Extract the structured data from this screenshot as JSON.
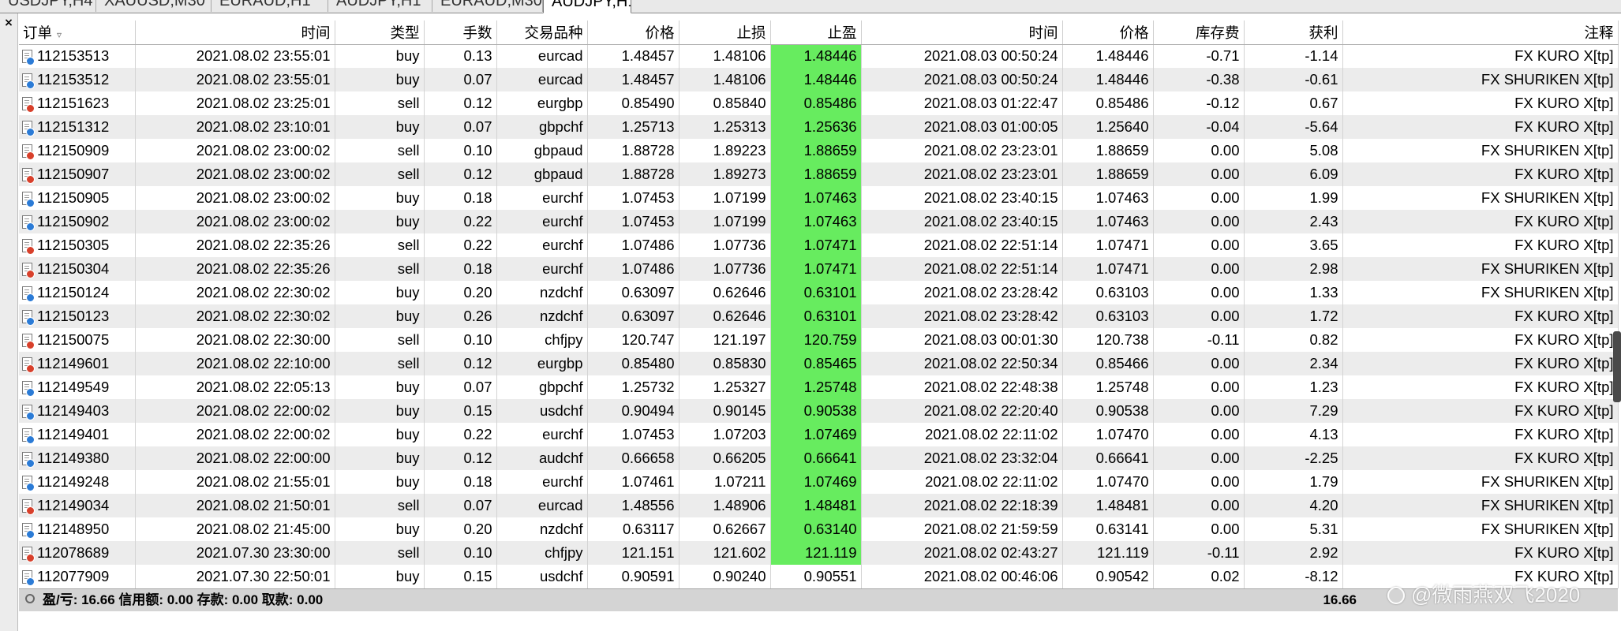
{
  "tabs": [
    {
      "label": "USDJPY,H4",
      "active": false
    },
    {
      "label": "XAUUSD,M30",
      "active": false
    },
    {
      "label": "EURAUD,H1",
      "active": false
    },
    {
      "label": "AUDJPY,H1",
      "active": false
    },
    {
      "label": "EURAUD,M30",
      "active": false
    },
    {
      "label": "AUDJPY,H1",
      "active": true
    }
  ],
  "close_label": "×",
  "columns": [
    "订单",
    "时间",
    "类型",
    "手数",
    "交易品种",
    "价格",
    "止损",
    "止盈",
    "时间",
    "价格",
    "库存费",
    "获利",
    "注释"
  ],
  "sort_indicator": "▿",
  "rows": [
    {
      "order": "112153513",
      "open_time": "2021.08.02 23:55:01",
      "type": "buy",
      "lots": "0.13",
      "symbol": "eurcad",
      "price": "1.48457",
      "sl": "1.48106",
      "tp": "1.48446",
      "close_time": "2021.08.03 00:50:24",
      "close_price": "1.48446",
      "swap": "-0.71",
      "profit": "-1.14",
      "comment": "FX KURO X[tp]",
      "tp_hit": true
    },
    {
      "order": "112153512",
      "open_time": "2021.08.02 23:55:01",
      "type": "buy",
      "lots": "0.07",
      "symbol": "eurcad",
      "price": "1.48457",
      "sl": "1.48106",
      "tp": "1.48446",
      "close_time": "2021.08.03 00:50:24",
      "close_price": "1.48446",
      "swap": "-0.38",
      "profit": "-0.61",
      "comment": "FX SHURIKEN X[tp]",
      "tp_hit": true
    },
    {
      "order": "112151623",
      "open_time": "2021.08.02 23:25:01",
      "type": "sell",
      "lots": "0.12",
      "symbol": "eurgbp",
      "price": "0.85490",
      "sl": "0.85840",
      "tp": "0.85486",
      "close_time": "2021.08.03 01:22:47",
      "close_price": "0.85486",
      "swap": "-0.12",
      "profit": "0.67",
      "comment": "FX KURO X[tp]",
      "tp_hit": true
    },
    {
      "order": "112151312",
      "open_time": "2021.08.02 23:10:01",
      "type": "buy",
      "lots": "0.07",
      "symbol": "gbpchf",
      "price": "1.25713",
      "sl": "1.25313",
      "tp": "1.25636",
      "close_time": "2021.08.03 01:00:05",
      "close_price": "1.25640",
      "swap": "-0.04",
      "profit": "-5.64",
      "comment": "FX KURO X[tp]",
      "tp_hit": true
    },
    {
      "order": "112150909",
      "open_time": "2021.08.02 23:00:02",
      "type": "sell",
      "lots": "0.10",
      "symbol": "gbpaud",
      "price": "1.88728",
      "sl": "1.89223",
      "tp": "1.88659",
      "close_time": "2021.08.02 23:23:01",
      "close_price": "1.88659",
      "swap": "0.00",
      "profit": "5.08",
      "comment": "FX SHURIKEN X[tp]",
      "tp_hit": true
    },
    {
      "order": "112150907",
      "open_time": "2021.08.02 23:00:02",
      "type": "sell",
      "lots": "0.12",
      "symbol": "gbpaud",
      "price": "1.88728",
      "sl": "1.89273",
      "tp": "1.88659",
      "close_time": "2021.08.02 23:23:01",
      "close_price": "1.88659",
      "swap": "0.00",
      "profit": "6.09",
      "comment": "FX KURO X[tp]",
      "tp_hit": true
    },
    {
      "order": "112150905",
      "open_time": "2021.08.02 23:00:02",
      "type": "buy",
      "lots": "0.18",
      "symbol": "eurchf",
      "price": "1.07453",
      "sl": "1.07199",
      "tp": "1.07463",
      "close_time": "2021.08.02 23:40:15",
      "close_price": "1.07463",
      "swap": "0.00",
      "profit": "1.99",
      "comment": "FX SHURIKEN X[tp]",
      "tp_hit": true
    },
    {
      "order": "112150902",
      "open_time": "2021.08.02 23:00:02",
      "type": "buy",
      "lots": "0.22",
      "symbol": "eurchf",
      "price": "1.07453",
      "sl": "1.07199",
      "tp": "1.07463",
      "close_time": "2021.08.02 23:40:15",
      "close_price": "1.07463",
      "swap": "0.00",
      "profit": "2.43",
      "comment": "FX KURO X[tp]",
      "tp_hit": true
    },
    {
      "order": "112150305",
      "open_time": "2021.08.02 22:35:26",
      "type": "sell",
      "lots": "0.22",
      "symbol": "eurchf",
      "price": "1.07486",
      "sl": "1.07736",
      "tp": "1.07471",
      "close_time": "2021.08.02 22:51:14",
      "close_price": "1.07471",
      "swap": "0.00",
      "profit": "3.65",
      "comment": "FX KURO X[tp]",
      "tp_hit": true
    },
    {
      "order": "112150304",
      "open_time": "2021.08.02 22:35:26",
      "type": "sell",
      "lots": "0.18",
      "symbol": "eurchf",
      "price": "1.07486",
      "sl": "1.07736",
      "tp": "1.07471",
      "close_time": "2021.08.02 22:51:14",
      "close_price": "1.07471",
      "swap": "0.00",
      "profit": "2.98",
      "comment": "FX SHURIKEN X[tp]",
      "tp_hit": true
    },
    {
      "order": "112150124",
      "open_time": "2021.08.02 22:30:02",
      "type": "buy",
      "lots": "0.20",
      "symbol": "nzdchf",
      "price": "0.63097",
      "sl": "0.62646",
      "tp": "0.63101",
      "close_time": "2021.08.02 23:28:42",
      "close_price": "0.63103",
      "swap": "0.00",
      "profit": "1.33",
      "comment": "FX SHURIKEN X[tp]",
      "tp_hit": true
    },
    {
      "order": "112150123",
      "open_time": "2021.08.02 22:30:02",
      "type": "buy",
      "lots": "0.26",
      "symbol": "nzdchf",
      "price": "0.63097",
      "sl": "0.62646",
      "tp": "0.63101",
      "close_time": "2021.08.02 23:28:42",
      "close_price": "0.63103",
      "swap": "0.00",
      "profit": "1.72",
      "comment": "FX KURO X[tp]",
      "tp_hit": true
    },
    {
      "order": "112150075",
      "open_time": "2021.08.02 22:30:00",
      "type": "sell",
      "lots": "0.10",
      "symbol": "chfjpy",
      "price": "120.747",
      "sl": "121.197",
      "tp": "120.759",
      "close_time": "2021.08.03 00:01:30",
      "close_price": "120.738",
      "swap": "-0.11",
      "profit": "0.82",
      "comment": "FX KURO X[tp]",
      "tp_hit": true
    },
    {
      "order": "112149601",
      "open_time": "2021.08.02 22:10:00",
      "type": "sell",
      "lots": "0.12",
      "symbol": "eurgbp",
      "price": "0.85480",
      "sl": "0.85830",
      "tp": "0.85465",
      "close_time": "2021.08.02 22:50:34",
      "close_price": "0.85466",
      "swap": "0.00",
      "profit": "2.34",
      "comment": "FX KURO X[tp]",
      "tp_hit": true
    },
    {
      "order": "112149549",
      "open_time": "2021.08.02 22:05:13",
      "type": "buy",
      "lots": "0.07",
      "symbol": "gbpchf",
      "price": "1.25732",
      "sl": "1.25327",
      "tp": "1.25748",
      "close_time": "2021.08.02 22:48:38",
      "close_price": "1.25748",
      "swap": "0.00",
      "profit": "1.23",
      "comment": "FX KURO X[tp]",
      "tp_hit": true
    },
    {
      "order": "112149403",
      "open_time": "2021.08.02 22:00:02",
      "type": "buy",
      "lots": "0.15",
      "symbol": "usdchf",
      "price": "0.90494",
      "sl": "0.90145",
      "tp": "0.90538",
      "close_time": "2021.08.02 22:20:40",
      "close_price": "0.90538",
      "swap": "0.00",
      "profit": "7.29",
      "comment": "FX KURO X[tp]",
      "tp_hit": true
    },
    {
      "order": "112149401",
      "open_time": "2021.08.02 22:00:02",
      "type": "buy",
      "lots": "0.22",
      "symbol": "eurchf",
      "price": "1.07453",
      "sl": "1.07203",
      "tp": "1.07469",
      "close_time": "2021.08.02 22:11:02",
      "close_price": "1.07470",
      "swap": "0.00",
      "profit": "4.13",
      "comment": "FX KURO X[tp]",
      "tp_hit": true
    },
    {
      "order": "112149380",
      "open_time": "2021.08.02 22:00:00",
      "type": "buy",
      "lots": "0.12",
      "symbol": "audchf",
      "price": "0.66658",
      "sl": "0.66205",
      "tp": "0.66641",
      "close_time": "2021.08.02 23:32:04",
      "close_price": "0.66641",
      "swap": "0.00",
      "profit": "-2.25",
      "comment": "FX KURO X[tp]",
      "tp_hit": true
    },
    {
      "order": "112149248",
      "open_time": "2021.08.02 21:55:01",
      "type": "buy",
      "lots": "0.18",
      "symbol": "eurchf",
      "price": "1.07461",
      "sl": "1.07211",
      "tp": "1.07469",
      "close_time": "2021.08.02 22:11:02",
      "close_price": "1.07470",
      "swap": "0.00",
      "profit": "1.79",
      "comment": "FX SHURIKEN X[tp]",
      "tp_hit": true
    },
    {
      "order": "112149034",
      "open_time": "2021.08.02 21:50:01",
      "type": "sell",
      "lots": "0.07",
      "symbol": "eurcad",
      "price": "1.48556",
      "sl": "1.48906",
      "tp": "1.48481",
      "close_time": "2021.08.02 22:18:39",
      "close_price": "1.48481",
      "swap": "0.00",
      "profit": "4.20",
      "comment": "FX SHURIKEN X[tp]",
      "tp_hit": true
    },
    {
      "order": "112148950",
      "open_time": "2021.08.02 21:45:00",
      "type": "buy",
      "lots": "0.20",
      "symbol": "nzdchf",
      "price": "0.63117",
      "sl": "0.62667",
      "tp": "0.63140",
      "close_time": "2021.08.02 21:59:59",
      "close_price": "0.63141",
      "swap": "0.00",
      "profit": "5.31",
      "comment": "FX SHURIKEN X[tp]",
      "tp_hit": true
    },
    {
      "order": "112078689",
      "open_time": "2021.07.30 23:30:00",
      "type": "sell",
      "lots": "0.10",
      "symbol": "chfjpy",
      "price": "121.151",
      "sl": "121.602",
      "tp": "121.119",
      "close_time": "2021.08.02 02:43:27",
      "close_price": "121.119",
      "swap": "-0.11",
      "profit": "2.92",
      "comment": "FX KURO X[tp]",
      "tp_hit": true
    },
    {
      "order": "112077909",
      "open_time": "2021.07.30 22:50:01",
      "type": "buy",
      "lots": "0.15",
      "symbol": "usdchf",
      "price": "0.90591",
      "sl": "0.90240",
      "tp": "0.90551",
      "close_time": "2021.08.02 00:46:06",
      "close_price": "0.90542",
      "swap": "0.02",
      "profit": "-8.12",
      "comment": "FX KURO X[tp]",
      "tp_hit": false
    }
  ],
  "summary": {
    "text": "盈/亏: 16.66  信用额: 0.00  存款: 0.00  取款: 0.00",
    "total_profit": "16.66"
  },
  "watermark": "@微雨燕双飞2020",
  "colors": {
    "tp_highlight": "#67ec5f",
    "row_alt": "#ececec",
    "buy_icon": "#2b7bd6",
    "sell_icon": "#d8402b",
    "summary_bg": "#d4d4d4"
  }
}
